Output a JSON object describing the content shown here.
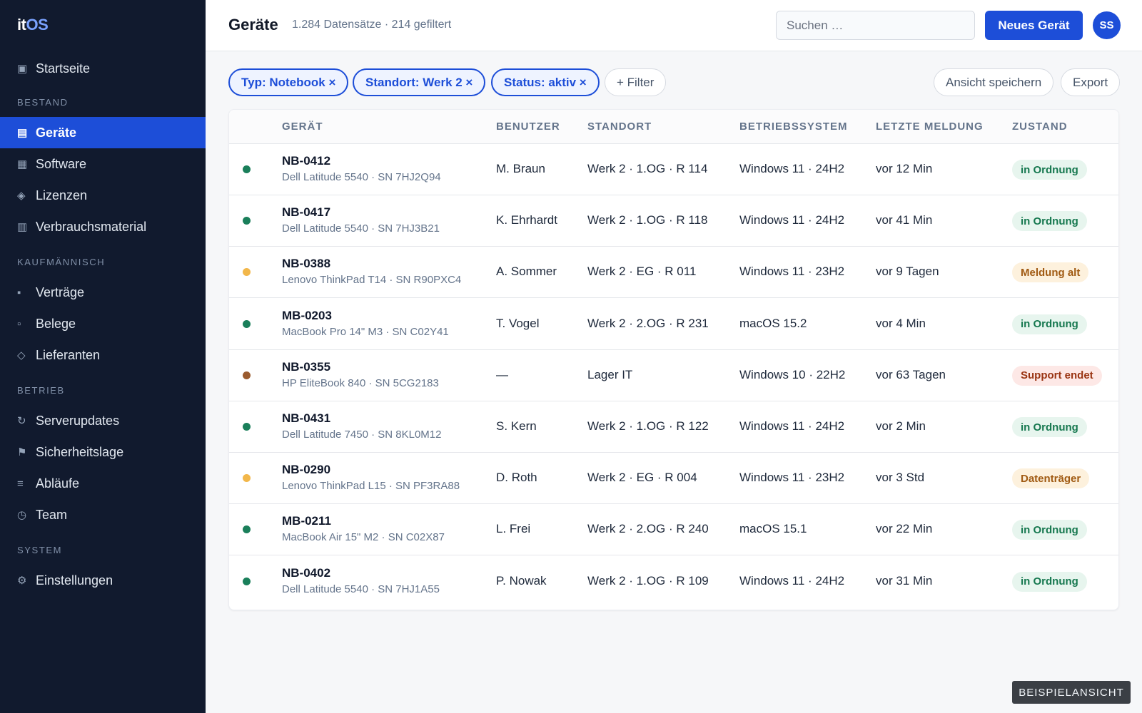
{
  "app": {
    "logo_it": "it",
    "logo_os": "OS"
  },
  "sidebar": {
    "home": {
      "label": "Startseite",
      "icon": "▣"
    },
    "sections": [
      {
        "label": "Bestand",
        "items": [
          {
            "label": "Geräte",
            "icon": "▤",
            "active": true
          },
          {
            "label": "Software",
            "icon": "▦"
          },
          {
            "label": "Lizenzen",
            "icon": "◈"
          },
          {
            "label": "Verbrauchsmaterial",
            "icon": "▥"
          }
        ]
      },
      {
        "label": "Kaufmännisch",
        "items": [
          {
            "label": "Verträge",
            "icon": "▪"
          },
          {
            "label": "Belege",
            "icon": "▫"
          },
          {
            "label": "Lieferanten",
            "icon": "◇"
          }
        ]
      },
      {
        "label": "Betrieb",
        "items": [
          {
            "label": "Serverupdates",
            "icon": "↻"
          },
          {
            "label": "Sicherheitslage",
            "icon": "⚑"
          },
          {
            "label": "Abläufe",
            "icon": "≡"
          },
          {
            "label": "Team",
            "icon": "◷"
          }
        ]
      },
      {
        "label": "System",
        "items": [
          {
            "label": "Einstellungen",
            "icon": "⚙"
          }
        ]
      }
    ]
  },
  "header": {
    "title": "Geräte",
    "meta": "1.284 Datensätze · 214 gefiltert",
    "search_placeholder": "Suchen …",
    "new_button": "Neues Gerät",
    "avatar_initials": "SS"
  },
  "filters": {
    "chips": [
      "Typ: Notebook ×",
      "Standort: Werk 2 ×",
      "Status: aktiv ×"
    ],
    "add_filter": "+ Filter",
    "save_view": "Ansicht speichern",
    "export": "Export"
  },
  "table": {
    "columns": [
      "Gerät",
      "Benutzer",
      "Standort",
      "Betriebssystem",
      "Letzte Meldung",
      "Zustand"
    ],
    "rows": [
      {
        "status_color": "#1a7f5a",
        "id": "NB-0412",
        "model": "Dell Latitude 5540 · SN 7HJ2Q94",
        "user": "M. Braun",
        "location": "Werk 2 · 1.OG · R 114",
        "os": "Windows 11 · 24H2",
        "last_report": "vor 12 Min",
        "state": "in Ordnung",
        "state_kind": "ok"
      },
      {
        "status_color": "#1a7f5a",
        "id": "NB-0417",
        "model": "Dell Latitude 5540 · SN 7HJ3B21",
        "user": "K. Ehrhardt",
        "location": "Werk 2 · 1.OG · R 118",
        "os": "Windows 11 · 24H2",
        "last_report": "vor 41 Min",
        "state": "in Ordnung",
        "state_kind": "ok"
      },
      {
        "status_color": "#f2b74a",
        "id": "NB-0388",
        "model": "Lenovo ThinkPad T14 · SN R90PXC4",
        "user": "A. Sommer",
        "location": "Werk 2 · EG · R 011",
        "os": "Windows 11 · 23H2",
        "last_report": "vor 9 Tagen",
        "state": "Meldung alt",
        "state_kind": "warn"
      },
      {
        "status_color": "#1a7f5a",
        "id": "MB-0203",
        "model": "MacBook Pro 14\" M3 · SN C02Y41",
        "user": "T. Vogel",
        "location": "Werk 2 · 2.OG · R 231",
        "os": "macOS 15.2",
        "last_report": "vor 4 Min",
        "state": "in Ordnung",
        "state_kind": "ok"
      },
      {
        "status_color": "#9a5b2e",
        "id": "NB-0355",
        "model": "HP EliteBook 840 · SN 5CG2183",
        "user": "—",
        "location": "Lager IT",
        "os": "Windows 10 · 22H2",
        "last_report": "vor 63 Tagen",
        "state": "Support endet",
        "state_kind": "danger"
      },
      {
        "status_color": "#1a7f5a",
        "id": "NB-0431",
        "model": "Dell Latitude 7450 · SN 8KL0M12",
        "user": "S. Kern",
        "location": "Werk 2 · 1.OG · R 122",
        "os": "Windows 11 · 24H2",
        "last_report": "vor 2 Min",
        "state": "in Ordnung",
        "state_kind": "ok"
      },
      {
        "status_color": "#f2b74a",
        "id": "NB-0290",
        "model": "Lenovo ThinkPad L15 · SN PF3RA88",
        "user": "D. Roth",
        "location": "Werk 2 · EG · R 004",
        "os": "Windows 11 · 23H2",
        "last_report": "vor 3 Std",
        "state": "Datenträger",
        "state_kind": "warn"
      },
      {
        "status_color": "#1a7f5a",
        "id": "MB-0211",
        "model": "MacBook Air 15\" M2 · SN C02X87",
        "user": "L. Frei",
        "location": "Werk 2 · 2.OG · R 240",
        "os": "macOS 15.1",
        "last_report": "vor 22 Min",
        "state": "in Ordnung",
        "state_kind": "ok"
      },
      {
        "status_color": "#1a7f5a",
        "id": "NB-0402",
        "model": "Dell Latitude 5540 · SN 7HJ1A55",
        "user": "P. Nowak",
        "location": "Werk 2 · 1.OG · R 109",
        "os": "Windows 11 · 24H2",
        "last_report": "vor 31 Min",
        "state": "in Ordnung",
        "state_kind": "ok"
      }
    ]
  },
  "badge_styles": {
    "ok": {
      "bg": "#e7f5ee",
      "fg": "#16784f"
    },
    "warn": {
      "bg": "#fdf1dd",
      "fg": "#a05a12"
    },
    "danger": {
      "bg": "#fde8e6",
      "fg": "#9a3412"
    }
  },
  "watermark": "BEISPIELANSICHT"
}
